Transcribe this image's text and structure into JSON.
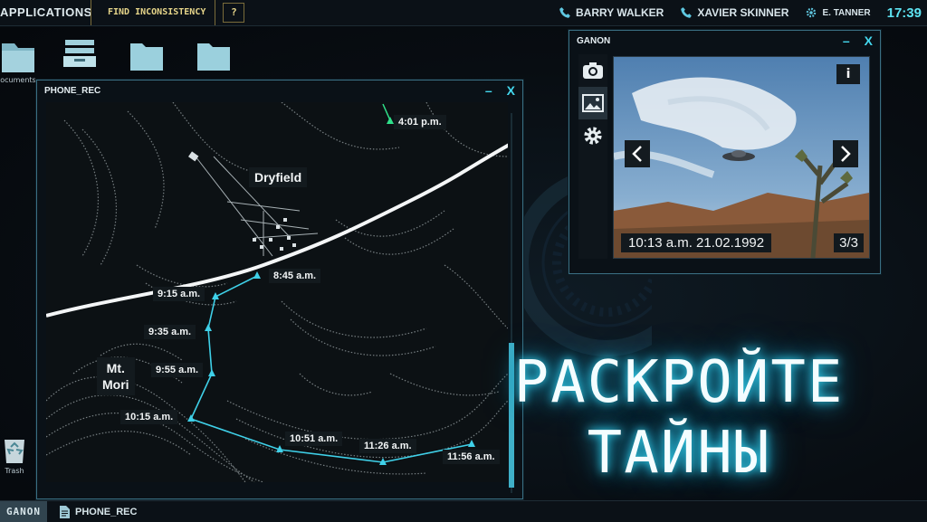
{
  "topbar": {
    "applications": "APPLICATIONS",
    "find_inconsistency": "FIND INCONSISTENCY",
    "help": "?",
    "contacts": [
      {
        "name": "BARRY WALKER",
        "icon": "phone-icon"
      },
      {
        "name": "XAVIER SKINNER",
        "icon": "phone-icon"
      },
      {
        "name": "E. TANNER",
        "icon": "gear-icon"
      }
    ],
    "clock": "17:39"
  },
  "desktop": {
    "documents_label": "ocuments",
    "trash_label": "Trash"
  },
  "phone_rec": {
    "title": "PHONE_REC",
    "places": {
      "dryfield": "Dryfield",
      "mountain": "Mt.\nMori"
    },
    "labels": {
      "t0401": "4:01 p.m.",
      "t0845": "8:45 a.m.",
      "t0915": "9:15 a.m.",
      "t0935": "9:35 a.m.",
      "t0955": "9:55 a.m.",
      "t1015": "10:15 a.m.",
      "t1051": "10:51 a.m.",
      "t1126": "11:26 a.m.",
      "t1156": "11:56 a.m."
    }
  },
  "ganon": {
    "title": "GANON",
    "photo_caption": "10:13 a.m. 21.02.1992",
    "photo_count": "3/3",
    "info": "i"
  },
  "promo": {
    "line1": "РАСКРОЙТЕ",
    "line2": "ТАЙНЫ"
  },
  "taskbar": {
    "start": "GANON",
    "item": "PHONE_REC"
  },
  "colors": {
    "accent": "#44d8ee",
    "route": "#3fd0e8",
    "gold": "#e6d58a"
  }
}
